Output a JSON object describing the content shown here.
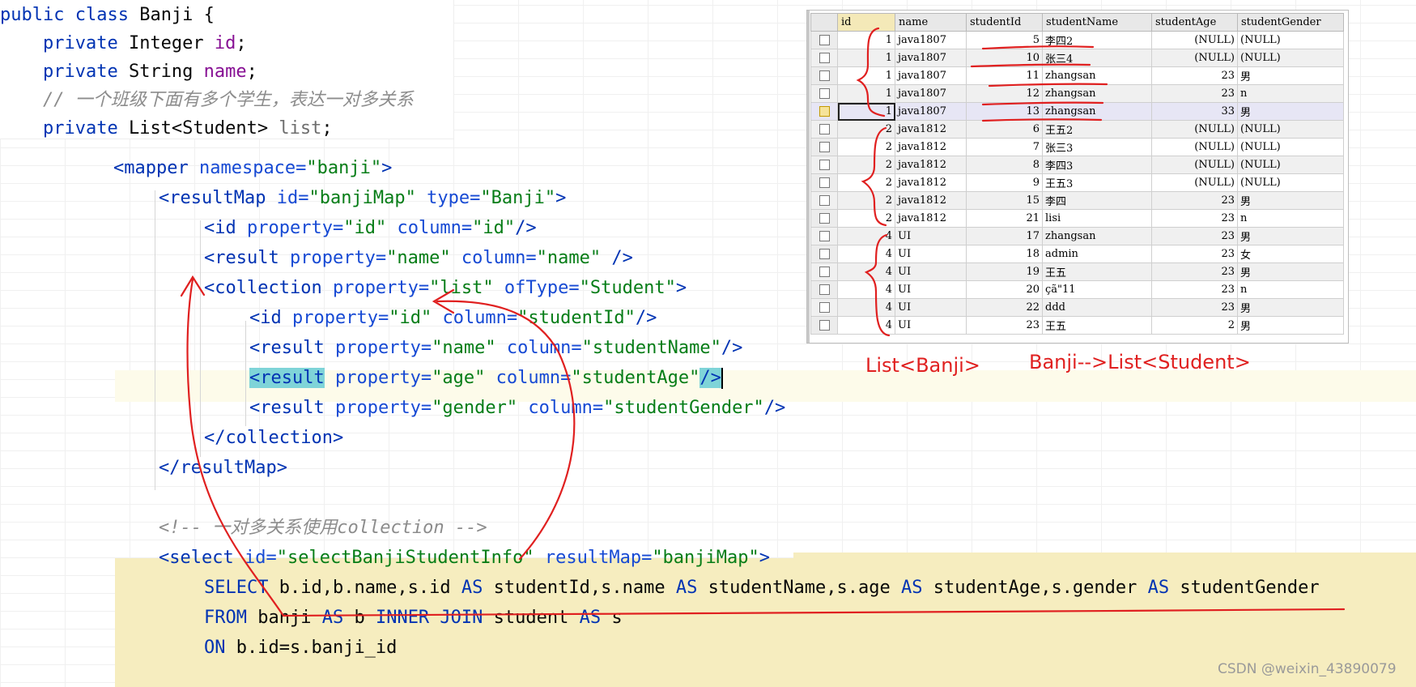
{
  "java_snippet": {
    "line1": {
      "kw": "public class",
      "name": " Banji {"
    },
    "line2": {
      "kw": "private",
      "type": " Integer ",
      "field": "id",
      "end": ";"
    },
    "line3": {
      "kw": "private",
      "type": " String ",
      "field": "name",
      "end": ";"
    },
    "line4": {
      "comment": "// 一个班级下面有多个学生，表达一对多关系"
    },
    "line5": {
      "kw": "private",
      "type": " List<Student> ",
      "field": "list",
      "end": ";"
    }
  },
  "xml": {
    "mapper_tag": "<mapper",
    "mapper_attr": "namespace=",
    "mapper_val": "\"banji\"",
    "resultmap_tag": "<resultMap",
    "resultmap_id_attr": "id=",
    "resultmap_id_val": "\"banjiMap\"",
    "resultmap_type_attr": "type=",
    "resultmap_type_val": "\"Banji\"",
    "id_tag": "<id",
    "id_prop": "property=",
    "id_prop_val": "\"id\"",
    "id_col": "column=",
    "id_col_val": "\"id\"",
    "result_name_tag": "<result",
    "result_name_prop_val": "\"name\"",
    "result_name_col_val": "\"name\"",
    "collection_tag": "<collection",
    "collection_prop_val": "\"list\"",
    "collection_oftype": "ofType=",
    "collection_oftype_val": "\"Student\"",
    "c_id_prop_val": "\"id\"",
    "c_id_col_val": "\"studentId\"",
    "c_name_prop_val": "\"name\"",
    "c_name_col_val": "\"studentName\"",
    "c_age_prop_val": "\"age\"",
    "c_age_col_val": "\"studentAge\"",
    "c_gender_prop_val": "\"gender\"",
    "c_gender_col_val": "\"studentGender\"",
    "close_collection": "</collection>",
    "close_resultmap": "</resultMap>",
    "comment": "<!-- 一对多关系使用collection -->",
    "select_tag": "<select",
    "select_id_attr": "id=",
    "select_id_val": "\"selectBanjiStudentInfo\"",
    "select_rm_attr": "resultMap=",
    "select_rm_val": "\"banjiMap\"",
    "sql_line1_kw": "SELECT",
    "sql_line1_rest": " b.id,b.name,s.id ",
    "sql_as": "AS",
    "sql_l1_a": " studentId,s.name ",
    "sql_l1_b": " studentName,s.age ",
    "sql_l1_c": " studentAge,s.gender ",
    "sql_l1_d": " studentGender",
    "sql_from": "FROM",
    "sql_l2_a": " banji ",
    "sql_l2_b": " b ",
    "sql_inner_join": "INNER JOIN",
    "sql_l2_c": " student ",
    "sql_l2_d": " s",
    "sql_on": "ON",
    "sql_l3": " b.id=s.banji_id"
  },
  "db_grid": {
    "columns": [
      "id",
      "name",
      "studentId",
      "studentName",
      "studentAge",
      "studentGender"
    ],
    "rows": [
      [
        "1",
        "java1807",
        "5",
        "李四2",
        "(NULL)",
        "(NULL)"
      ],
      [
        "1",
        "java1807",
        "10",
        "张三4",
        "(NULL)",
        "(NULL)"
      ],
      [
        "1",
        "java1807",
        "11",
        "zhangsan",
        "23",
        "男"
      ],
      [
        "1",
        "java1807",
        "12",
        "zhangsan",
        "23",
        "n"
      ],
      [
        "1",
        "java1807",
        "13",
        "zhangsan",
        "33",
        "男"
      ],
      [
        "2",
        "java1812",
        "6",
        "王五2",
        "(NULL)",
        "(NULL)"
      ],
      [
        "2",
        "java1812",
        "7",
        "张三3",
        "(NULL)",
        "(NULL)"
      ],
      [
        "2",
        "java1812",
        "8",
        "李四3",
        "(NULL)",
        "(NULL)"
      ],
      [
        "2",
        "java1812",
        "9",
        "王五3",
        "(NULL)",
        "(NULL)"
      ],
      [
        "2",
        "java1812",
        "15",
        "李四",
        "23",
        "男"
      ],
      [
        "2",
        "java1812",
        "21",
        "lisi",
        "23",
        "n"
      ],
      [
        "4",
        "UI",
        "17",
        "zhangsan",
        "23",
        "男"
      ],
      [
        "4",
        "UI",
        "18",
        "admin",
        "23",
        "女"
      ],
      [
        "4",
        "UI",
        "19",
        "王五",
        "23",
        "男"
      ],
      [
        "4",
        "UI",
        "20",
        "çã\"11",
        "23",
        "n"
      ],
      [
        "4",
        "UI",
        "22",
        "ddd",
        "23",
        "男"
      ],
      [
        "4",
        "UI",
        "23",
        "王五",
        "2",
        "男"
      ]
    ],
    "current_row": 4
  },
  "annotations": {
    "left_label": "List<Banji>",
    "right_label": "Banji-->List<Student>",
    "color": "#e02020"
  },
  "watermark": "CSDN @weixin_43890079"
}
